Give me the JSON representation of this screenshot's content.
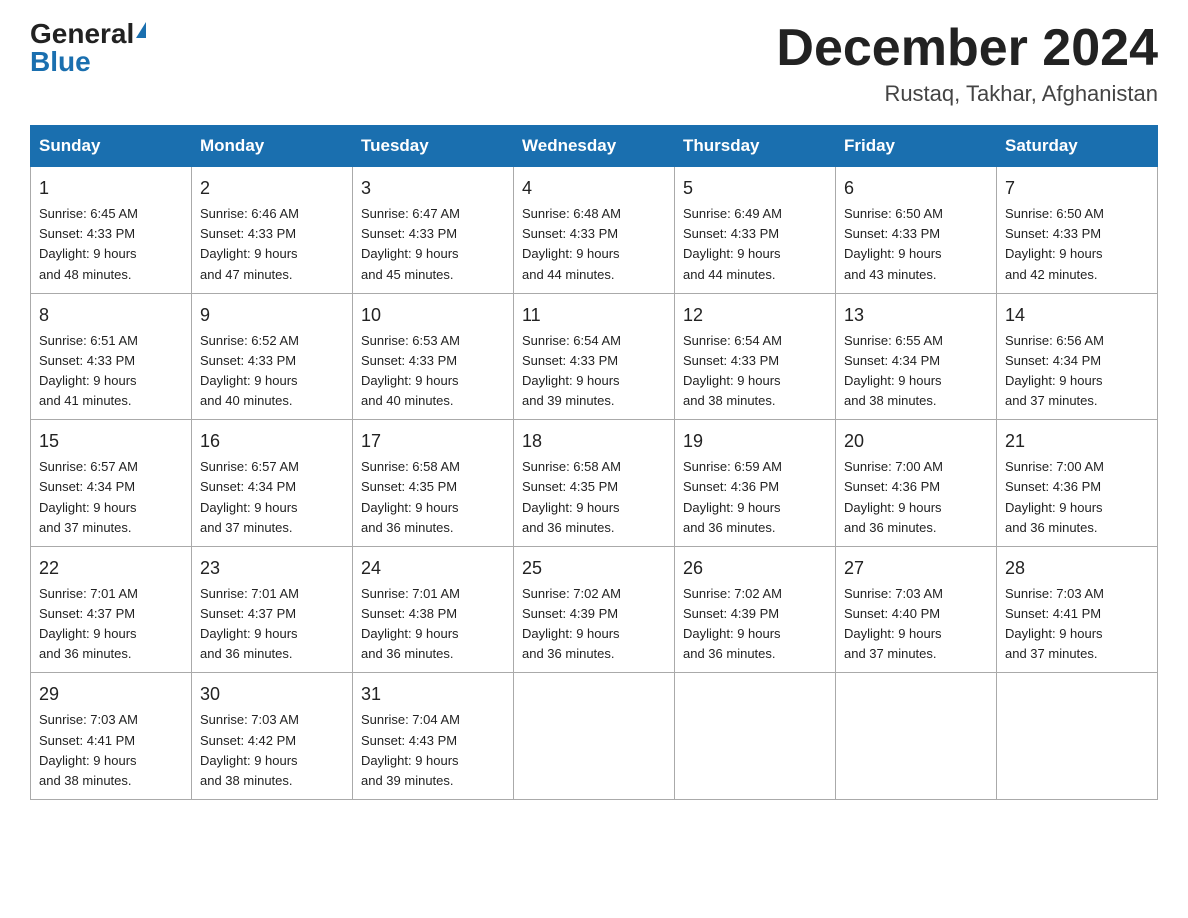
{
  "header": {
    "logo_general": "General",
    "logo_blue": "Blue",
    "title": "December 2024",
    "subtitle": "Rustaq, Takhar, Afghanistan"
  },
  "weekdays": [
    "Sunday",
    "Monday",
    "Tuesday",
    "Wednesday",
    "Thursday",
    "Friday",
    "Saturday"
  ],
  "weeks": [
    [
      {
        "day": "1",
        "sunrise": "6:45 AM",
        "sunset": "4:33 PM",
        "daylight": "9 hours and 48 minutes."
      },
      {
        "day": "2",
        "sunrise": "6:46 AM",
        "sunset": "4:33 PM",
        "daylight": "9 hours and 47 minutes."
      },
      {
        "day": "3",
        "sunrise": "6:47 AM",
        "sunset": "4:33 PM",
        "daylight": "9 hours and 45 minutes."
      },
      {
        "day": "4",
        "sunrise": "6:48 AM",
        "sunset": "4:33 PM",
        "daylight": "9 hours and 44 minutes."
      },
      {
        "day": "5",
        "sunrise": "6:49 AM",
        "sunset": "4:33 PM",
        "daylight": "9 hours and 44 minutes."
      },
      {
        "day": "6",
        "sunrise": "6:50 AM",
        "sunset": "4:33 PM",
        "daylight": "9 hours and 43 minutes."
      },
      {
        "day": "7",
        "sunrise": "6:50 AM",
        "sunset": "4:33 PM",
        "daylight": "9 hours and 42 minutes."
      }
    ],
    [
      {
        "day": "8",
        "sunrise": "6:51 AM",
        "sunset": "4:33 PM",
        "daylight": "9 hours and 41 minutes."
      },
      {
        "day": "9",
        "sunrise": "6:52 AM",
        "sunset": "4:33 PM",
        "daylight": "9 hours and 40 minutes."
      },
      {
        "day": "10",
        "sunrise": "6:53 AM",
        "sunset": "4:33 PM",
        "daylight": "9 hours and 40 minutes."
      },
      {
        "day": "11",
        "sunrise": "6:54 AM",
        "sunset": "4:33 PM",
        "daylight": "9 hours and 39 minutes."
      },
      {
        "day": "12",
        "sunrise": "6:54 AM",
        "sunset": "4:33 PM",
        "daylight": "9 hours and 38 minutes."
      },
      {
        "day": "13",
        "sunrise": "6:55 AM",
        "sunset": "4:34 PM",
        "daylight": "9 hours and 38 minutes."
      },
      {
        "day": "14",
        "sunrise": "6:56 AM",
        "sunset": "4:34 PM",
        "daylight": "9 hours and 37 minutes."
      }
    ],
    [
      {
        "day": "15",
        "sunrise": "6:57 AM",
        "sunset": "4:34 PM",
        "daylight": "9 hours and 37 minutes."
      },
      {
        "day": "16",
        "sunrise": "6:57 AM",
        "sunset": "4:34 PM",
        "daylight": "9 hours and 37 minutes."
      },
      {
        "day": "17",
        "sunrise": "6:58 AM",
        "sunset": "4:35 PM",
        "daylight": "9 hours and 36 minutes."
      },
      {
        "day": "18",
        "sunrise": "6:58 AM",
        "sunset": "4:35 PM",
        "daylight": "9 hours and 36 minutes."
      },
      {
        "day": "19",
        "sunrise": "6:59 AM",
        "sunset": "4:36 PM",
        "daylight": "9 hours and 36 minutes."
      },
      {
        "day": "20",
        "sunrise": "7:00 AM",
        "sunset": "4:36 PM",
        "daylight": "9 hours and 36 minutes."
      },
      {
        "day": "21",
        "sunrise": "7:00 AM",
        "sunset": "4:36 PM",
        "daylight": "9 hours and 36 minutes."
      }
    ],
    [
      {
        "day": "22",
        "sunrise": "7:01 AM",
        "sunset": "4:37 PM",
        "daylight": "9 hours and 36 minutes."
      },
      {
        "day": "23",
        "sunrise": "7:01 AM",
        "sunset": "4:37 PM",
        "daylight": "9 hours and 36 minutes."
      },
      {
        "day": "24",
        "sunrise": "7:01 AM",
        "sunset": "4:38 PM",
        "daylight": "9 hours and 36 minutes."
      },
      {
        "day": "25",
        "sunrise": "7:02 AM",
        "sunset": "4:39 PM",
        "daylight": "9 hours and 36 minutes."
      },
      {
        "day": "26",
        "sunrise": "7:02 AM",
        "sunset": "4:39 PM",
        "daylight": "9 hours and 36 minutes."
      },
      {
        "day": "27",
        "sunrise": "7:03 AM",
        "sunset": "4:40 PM",
        "daylight": "9 hours and 37 minutes."
      },
      {
        "day": "28",
        "sunrise": "7:03 AM",
        "sunset": "4:41 PM",
        "daylight": "9 hours and 37 minutes."
      }
    ],
    [
      {
        "day": "29",
        "sunrise": "7:03 AM",
        "sunset": "4:41 PM",
        "daylight": "9 hours and 38 minutes."
      },
      {
        "day": "30",
        "sunrise": "7:03 AM",
        "sunset": "4:42 PM",
        "daylight": "9 hours and 38 minutes."
      },
      {
        "day": "31",
        "sunrise": "7:04 AM",
        "sunset": "4:43 PM",
        "daylight": "9 hours and 39 minutes."
      },
      null,
      null,
      null,
      null
    ]
  ],
  "labels": {
    "sunrise": "Sunrise:",
    "sunset": "Sunset:",
    "daylight": "Daylight:"
  }
}
